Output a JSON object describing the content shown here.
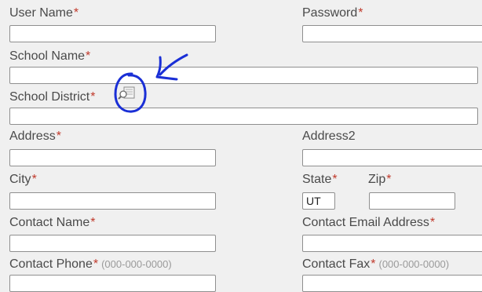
{
  "form": {
    "user_name": {
      "label": "User Name",
      "required_mark": "*",
      "value": ""
    },
    "password": {
      "label": "Password",
      "required_mark": "*",
      "value": ""
    },
    "school_name": {
      "label": "School Name",
      "required_mark": "*",
      "value": ""
    },
    "school_district": {
      "label": "School District",
      "required_mark": "*",
      "value": "",
      "lookup_icon": "lookup-icon"
    },
    "address": {
      "label": "Address",
      "required_mark": "*",
      "value": ""
    },
    "address2": {
      "label": "Address2",
      "value": ""
    },
    "city": {
      "label": "City",
      "required_mark": "*",
      "value": ""
    },
    "state": {
      "label": "State",
      "required_mark": "*",
      "value": "UT"
    },
    "zip": {
      "label": "Zip",
      "required_mark": "*",
      "value": ""
    },
    "contact_name": {
      "label": "Contact Name",
      "required_mark": "*",
      "value": ""
    },
    "contact_email": {
      "label": "Contact Email Address",
      "required_mark": "*",
      "value": ""
    },
    "contact_phone": {
      "label": "Contact Phone",
      "required_mark": "*",
      "hint": "(000-000-0000)",
      "value": ""
    },
    "contact_fax": {
      "label": "Contact Fax",
      "required_mark": "*",
      "hint": "(000-000-0000)",
      "value": ""
    }
  },
  "colors": {
    "background": "#f0f0f0",
    "label_text": "#4a4a4a",
    "required_mark": "#c0392b",
    "hint_text": "#9a9a9a",
    "annotation_ink": "#1a2fd6"
  }
}
